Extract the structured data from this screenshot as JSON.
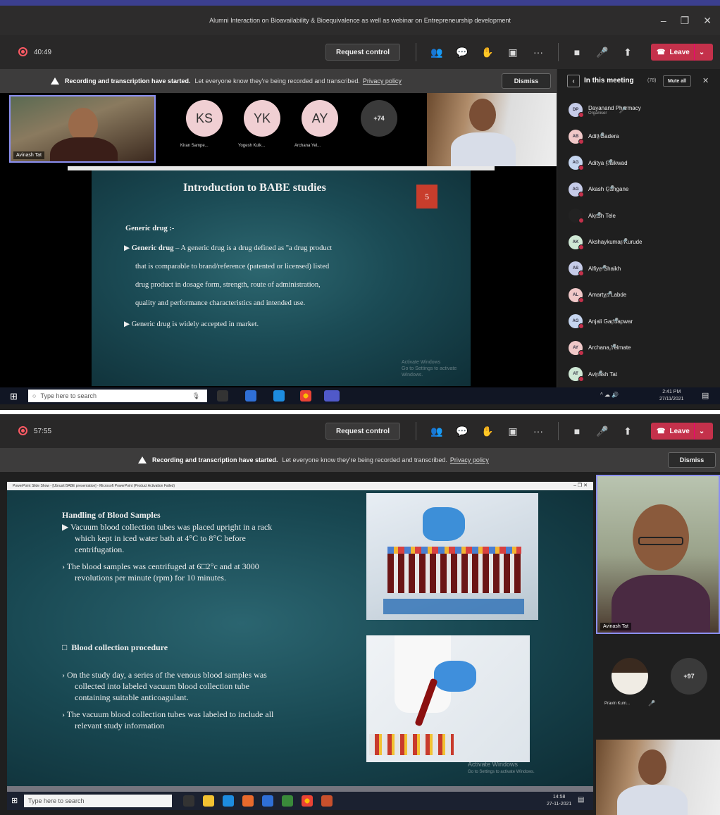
{
  "window_title": "Alumni Interaction on Bioavailability & Bioequivalence as well as webinar on Entrepreneurship development",
  "top": {
    "timer": "40:49",
    "request_control": "Request control",
    "leave": "Leave",
    "banner": {
      "bold": "Recording and transcription have started.",
      "text": "Let everyone know they're being recorded and transcribed.",
      "link": "Privacy policy",
      "dismiss": "Dismiss"
    },
    "speaker_video_name": "Avinash Tat",
    "avatars": [
      {
        "initials": "KS",
        "name": "Kiran Sampe...",
        "color": "#f2d4d4"
      },
      {
        "initials": "YK",
        "name": "Yogesh Kulk...",
        "color": "#f2d4d4"
      },
      {
        "initials": "AY",
        "name": "Archana Yel...",
        "color": "#f2d4d4"
      }
    ],
    "more_count": "+74",
    "slide": {
      "title": "Introduction to BABE studies",
      "number": "5",
      "heading": "Generic drug :-",
      "bullet1_bold": "Generic drug",
      "bullet1_lines": [
        "– A generic drug is a drug defined as \"a drug product",
        "that is comparable to brand/reference (patented or licensed) listed",
        "drug product in dosage form, strength, route of administration,",
        "quality and performance characteristics and intended use."
      ],
      "bullet2": "Generic drug is widely accepted in market.",
      "watermark1": "Activate Windows",
      "watermark2": "Go to Settings to activate Windows."
    },
    "panel": {
      "title": "In this meeting",
      "count": "(78)",
      "mute_all": "Mute all",
      "participants": [
        {
          "initials": "DP",
          "name": "Dayanand Pharmacy",
          "sub": "Organiser",
          "color": "#c5cbe8"
        },
        {
          "initials": "AB",
          "name": "Aditi Badera",
          "sub": "",
          "color": "#f0c8c8"
        },
        {
          "initials": "AG",
          "name": "Aditya Gaikwad",
          "sub": "",
          "color": "#c5d5ef"
        },
        {
          "initials": "AG",
          "name": "Akash Gangane",
          "sub": "",
          "color": "#c5cbe8"
        },
        {
          "initials": "",
          "name": "Akash Tele",
          "sub": "",
          "color": "#222"
        },
        {
          "initials": "AK",
          "name": "Akshaykumar Kurude",
          "sub": "",
          "color": "#cfe8d5"
        },
        {
          "initials": "AS",
          "name": "Alfiya Shaikh",
          "sub": "",
          "color": "#c5cbe8"
        },
        {
          "initials": "AL",
          "name": "Amartya Labde",
          "sub": "",
          "color": "#f0c8c8"
        },
        {
          "initials": "AG",
          "name": "Anjali Gaddapwar",
          "sub": "",
          "color": "#c5d5ef"
        },
        {
          "initials": "AY",
          "name": "Archana Yelmate",
          "sub": "",
          "color": "#f0c8c8"
        },
        {
          "initials": "AT",
          "name": "Avinash Tat",
          "sub": "",
          "color": "#cfe8d5"
        }
      ]
    },
    "taskbar": {
      "search_placeholder": "Type here to search",
      "time": "2:41 PM",
      "date": "27/11/2021"
    }
  },
  "bottom": {
    "timer": "57:55",
    "request_control": "Request control",
    "leave": "Leave",
    "banner": {
      "bold": "Recording and transcription have started.",
      "text": "Let everyone know they're being recorded and transcribed.",
      "link": "Privacy policy",
      "dismiss": "Dismiss"
    },
    "ppt_title": "PowerPoint Slide Show - [Ubrusit BABE presentation] - Microsoft PowerPoint (Product Activation Failed)",
    "slide": {
      "heading1": "Handling of Blood Samples",
      "b1_lines": [
        "Vacuum blood collection tubes was placed upright in a rack",
        "which kept in iced water bath at 4°C to 8°C before",
        "centrifugation."
      ],
      "b2_lines": [
        "The blood samples was centrifuged at 6□2°c and at 3000",
        "revolutions per minute (rpm) for 10 minutes."
      ],
      "heading2": "Blood collection procedure",
      "b3_lines": [
        "On the study day, a series of the venous blood samples was",
        "collected into labeled vacuum blood collection tube",
        "containing suitable anticoagulant."
      ],
      "b4_lines": [
        "The vacuum blood collection tubes was labeled to include all",
        "relevant study information"
      ],
      "watermark1": "Activate Windows",
      "watermark2": "Go to Settings to activate Windows."
    },
    "speaker_name": "Avinash Tat",
    "side_participant": "Pravin Kum...",
    "more_count": "+97",
    "taskbar": {
      "search_placeholder": "Type here to search",
      "time": "14:58",
      "date": "27-11-2021"
    }
  }
}
